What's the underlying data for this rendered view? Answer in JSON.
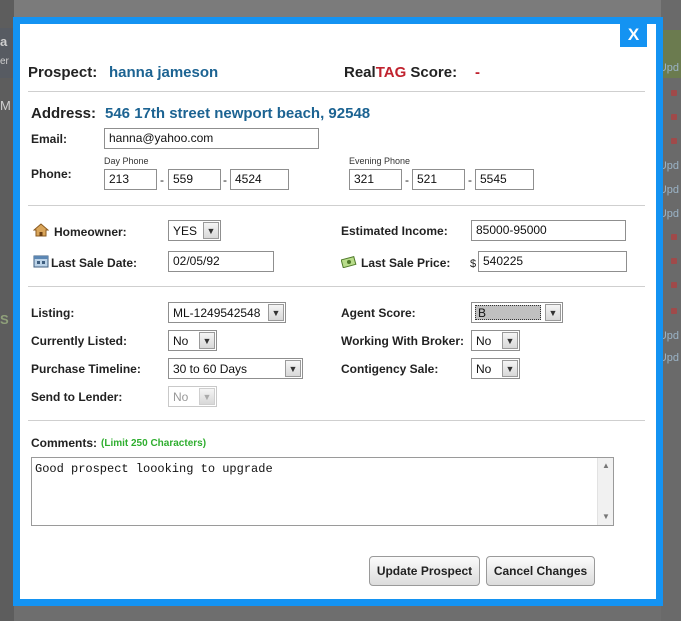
{
  "background": {
    "left_letters": [
      "a",
      "er",
      "M",
      "S"
    ],
    "right_labels": [
      "Upd",
      "Upd",
      "Upd",
      "Upd",
      "Upd",
      "Upd"
    ]
  },
  "modal": {
    "close_label": "X",
    "prospect_label": "Prospect:",
    "prospect_name": "hanna jameson",
    "score_prefix": "Real",
    "score_tag": "TAG",
    "score_suffix": "Score:",
    "score_value": "-",
    "address_label": "Address:",
    "address_value": "546 17th street newport beach, 92548",
    "email_label": "Email:",
    "email_value": "hanna@yahoo.com",
    "phone_label": "Phone:",
    "day_phone_label": "Day Phone",
    "day_phone": [
      "213",
      "559",
      "4524"
    ],
    "evening_phone_label": "Evening Phone",
    "evening_phone": [
      "321",
      "521",
      "5545"
    ],
    "dash": "-",
    "homeowner_label": "Homeowner:",
    "homeowner_value": "YES",
    "last_sale_date_label": "Last Sale Date:",
    "last_sale_date_value": "02/05/92",
    "estimated_income_label": "Estimated Income:",
    "estimated_income_value": "85000-95000",
    "last_sale_price_label": "Last Sale Price:",
    "currency_symbol": "$",
    "last_sale_price_value": "540225",
    "listing_label": "Listing:",
    "listing_value": "ML-1249542548",
    "currently_listed_label": "Currently Listed:",
    "currently_listed_value": "No",
    "purchase_timeline_label": "Purchase Timeline:",
    "purchase_timeline_value": "30 to 60 Days",
    "send_to_lender_label": "Send to Lender:",
    "send_to_lender_value": "No",
    "agent_score_label": "Agent Score:",
    "agent_score_value": "B",
    "working_with_broker_label": "Working With Broker:",
    "working_with_broker_value": "No",
    "contingency_label": "Contigency Sale:",
    "contingency_value": "No",
    "comments_label": "Comments:",
    "comments_limit": "(Limit 250 Characters)",
    "comments_value": "Good prospect loooking to upgrade",
    "update_button": "Update Prospect",
    "cancel_button": "Cancel Changes"
  },
  "colors": {
    "modal_border": "#1493f2",
    "name_blue": "#1c6392",
    "tag_red": "#c0222e",
    "limit_green": "#2fae2f"
  }
}
